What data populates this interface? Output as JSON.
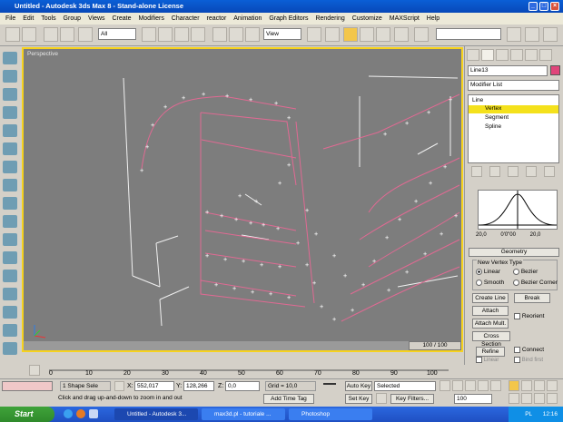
{
  "window": {
    "title": "Untitled - Autodesk 3ds Max 8 - Stand-alone License"
  },
  "menu": [
    "File",
    "Edit",
    "Tools",
    "Group",
    "Views",
    "Create",
    "Modifiers",
    "Character",
    "reactor",
    "Animation",
    "Graph Editors",
    "Rendering",
    "Customize",
    "MAXScript",
    "Help"
  ],
  "toolbar": {
    "selection_filter": "All",
    "ref_coord": "View"
  },
  "viewport": {
    "label": "Perspective",
    "scroll_label": "100 / 100"
  },
  "command_panel": {
    "object_name": "Line13",
    "object_color": "#e0447a",
    "modifier_list": "Modifier List",
    "stack": [
      "Line",
      "Vertex",
      "Segment",
      "Spline"
    ],
    "graph_labels": [
      "20,0",
      "0'0\"00",
      "20,0"
    ],
    "rollout_title": "Geometry",
    "new_vertex_type": "New Vertex Type",
    "options": {
      "linear": "Linear",
      "bezier": "Bezier",
      "smooth": "Smooth",
      "bezier_corner": "Bezier Corner"
    },
    "buttons": {
      "create_line": "Create Line",
      "break": "Break",
      "attach": "Attach",
      "attach_mult": "Attach Mult.",
      "reorient": "Reorient",
      "cross_section": "Cross Section",
      "refine": "Refine",
      "connect": "Connect",
      "linear": "Linear",
      "bind_first": "Bind first",
      "closed": "Closed",
      "bind_last": "Bind last"
    }
  },
  "timeline": {
    "ticks": [
      "0",
      "10",
      "20",
      "30",
      "40",
      "50",
      "60",
      "70",
      "80",
      "90",
      "100"
    ]
  },
  "status": {
    "selection": "1 Shape Sele",
    "x_label": "X:",
    "x": "552,017",
    "y_label": "Y:",
    "y": "128,266",
    "z_label": "Z:",
    "z": "0,0",
    "grid": "Grid = 10,0",
    "prompt": "Click and drag up-and-down to zoom in and out",
    "add_time_tag": "Add Time Tag",
    "auto_key": "Auto Key",
    "set_key": "Set Key",
    "selected": "Selected",
    "key_filters": "Key Filters...",
    "frame": "100"
  },
  "taskbar": {
    "start": "Start",
    "tasks": [
      "Untitled - Autodesk 3...",
      "max3d.pl - tutoriale ...",
      "Photoshop"
    ],
    "lang": "PL",
    "clock": "12:16"
  }
}
